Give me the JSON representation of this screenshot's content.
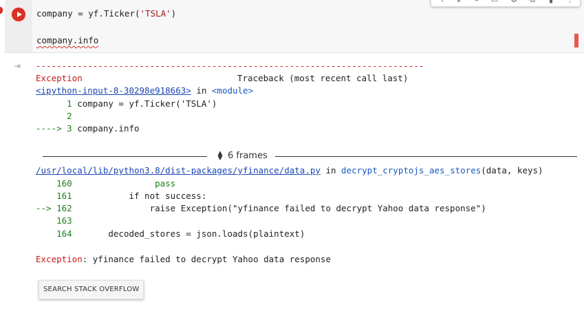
{
  "toolbar": {
    "icons": [
      "move-up-icon",
      "move-down-icon",
      "link-icon",
      "comment-icon",
      "settings-icon",
      "mirror-cell-icon",
      "delete-icon",
      "more-icon"
    ]
  },
  "cell": {
    "line1_pre": "company = yf.Ticker(",
    "line1_str": "'TSLA'",
    "line1_post": ")",
    "line2": "company.info"
  },
  "traceback": {
    "dashes": "---------------------------------------------------------------------------",
    "exception_label": "Exception",
    "traceback_header": "Traceback (most recent call last)",
    "input_link": "<ipython-input-8-30298e918663>",
    "in_word": "in",
    "module": "<module>",
    "frame1": [
      {
        "num": "      1",
        "code": " company = yf.Ticker('TSLA')"
      },
      {
        "num": "      2",
        "code": ""
      },
      {
        "arrow": "----> 3",
        "code": " company.info"
      }
    ],
    "frames_label": "6 frames",
    "file_link": "/usr/local/lib/python3.8/dist-packages/yfinance/data.py",
    "func": "decrypt_cryptojs_aes_stores",
    "func_args": "(data, keys)",
    "frame2": [
      {
        "num": "    160",
        "code": "                pass"
      },
      {
        "num": "    161",
        "code": "           if not success:"
      },
      {
        "arrow": "--> 162",
        "code": "               raise Exception(\"yfinance failed to decrypt Yahoo data response\")"
      },
      {
        "num": "    163",
        "code": ""
      },
      {
        "num": "    164",
        "code": "       decoded_stores = json.loads(plaintext)"
      }
    ],
    "final_label": "Exception",
    "final_message": ": yfinance failed to decrypt Yahoo data response"
  },
  "search_button": "SEARCH STACK OVERFLOW"
}
